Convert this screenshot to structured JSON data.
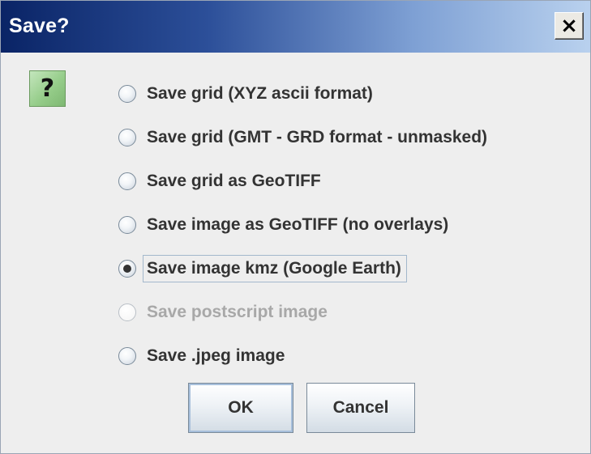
{
  "window": {
    "title": "Save?",
    "close_glyph": "×",
    "close_icon": "close-icon"
  },
  "dialog": {
    "icon": "question-icon",
    "icon_glyph": "?",
    "icon_color": "#96cd8a",
    "options": [
      {
        "label": "Save grid (XYZ ascii format)",
        "selected": false,
        "enabled": true
      },
      {
        "label": "Save grid (GMT - GRD format - unmasked)",
        "selected": false,
        "enabled": true
      },
      {
        "label": "Save grid as GeoTIFF",
        "selected": false,
        "enabled": true
      },
      {
        "label": "Save image as GeoTIFF (no overlays)",
        "selected": false,
        "enabled": true
      },
      {
        "label": "Save image kmz (Google Earth)",
        "selected": true,
        "enabled": true
      },
      {
        "label": "Save postscript image",
        "selected": false,
        "enabled": false
      },
      {
        "label": "Save .jpeg image",
        "selected": false,
        "enabled": true
      }
    ],
    "ok_label": "OK",
    "cancel_label": "Cancel"
  },
  "colors": {
    "titlebar_start": "#0a2466",
    "titlebar_end": "#b9d1ee",
    "background": "#eeeeee",
    "disabled_text": "#a8a8a8"
  }
}
